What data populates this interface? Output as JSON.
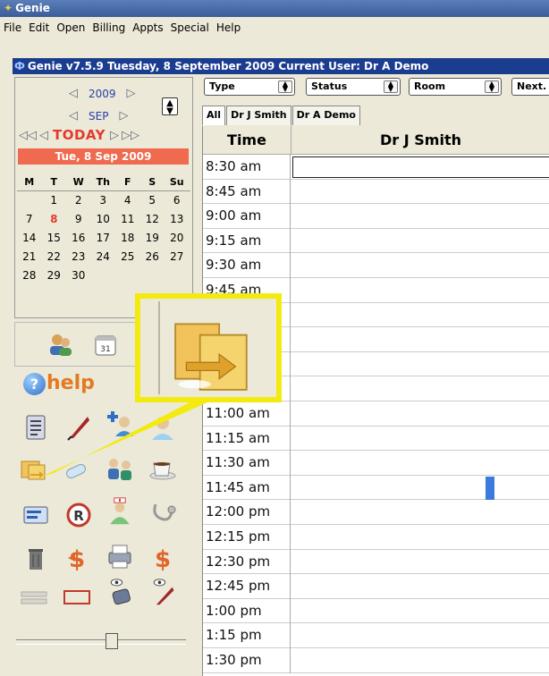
{
  "window": {
    "title": "Genie"
  },
  "menu": [
    "File",
    "Edit",
    "Open",
    "Billing",
    "Appts",
    "Special",
    "Help"
  ],
  "infobar": {
    "text": "Genie v7.5.9  Tuesday, 8 September 2009  Current User: Dr A Demo"
  },
  "calendar": {
    "year": "2009",
    "month": "SEP",
    "today_label": "TODAY",
    "selected_date": "Tue, 8 Sep 2009",
    "weekdays": [
      "M",
      "T",
      "W",
      "Th",
      "F",
      "S",
      "Su"
    ],
    "weeks": [
      [
        "",
        "1",
        "2",
        "3",
        "4",
        "5",
        "6"
      ],
      [
        "7",
        "8",
        "9",
        "10",
        "11",
        "12",
        "13"
      ],
      [
        "14",
        "15",
        "16",
        "17",
        "18",
        "19",
        "20"
      ],
      [
        "21",
        "22",
        "23",
        "24",
        "25",
        "26",
        "27"
      ],
      [
        "28",
        "29",
        "30",
        "",
        "",
        "",
        ""
      ]
    ],
    "today_day": "8"
  },
  "help": {
    "label": "help"
  },
  "toolbar": {
    "type_label": "Type",
    "status_label": "Status",
    "room_label": "Room",
    "next_label": "Next."
  },
  "tabs": [
    "All",
    "Dr J Smith",
    "Dr A Demo"
  ],
  "grid": {
    "time_header": "Time",
    "provider_header": "Dr J Smith",
    "times": [
      "8:30 am",
      "8:45 am",
      "9:00 am",
      "9:15 am",
      "9:30 am",
      "9:45 am",
      "",
      "",
      "",
      "",
      "11:00 am",
      "11:15 am",
      "11:30 am",
      "11:45 am",
      "12:00 pm",
      "12:15 pm",
      "12:30 pm",
      "12:45 pm",
      "1:00 pm",
      "1:15 pm",
      "1:30 pm"
    ]
  },
  "colors": {
    "callout_border": "#f3ea10",
    "today_red": "#e33b2e",
    "infobar_blue": "#1b3d8f"
  },
  "icons": [
    "patient-list-icon",
    "quill-pen-icon",
    "doctor-plus-icon",
    "doctor-icon",
    "folder-transfer-icon",
    "pills-icon",
    "users-icon",
    "coffee-cup-icon",
    "card-icon",
    "registered-icon",
    "nurse-icon",
    "stethoscope-icon",
    "trash-icon",
    "dollar-arrow-icon",
    "printer-icon",
    "dollar-icon",
    "bar-icon",
    "red-frame-icon",
    "eye-phone-icon",
    "eye-pen-icon"
  ]
}
